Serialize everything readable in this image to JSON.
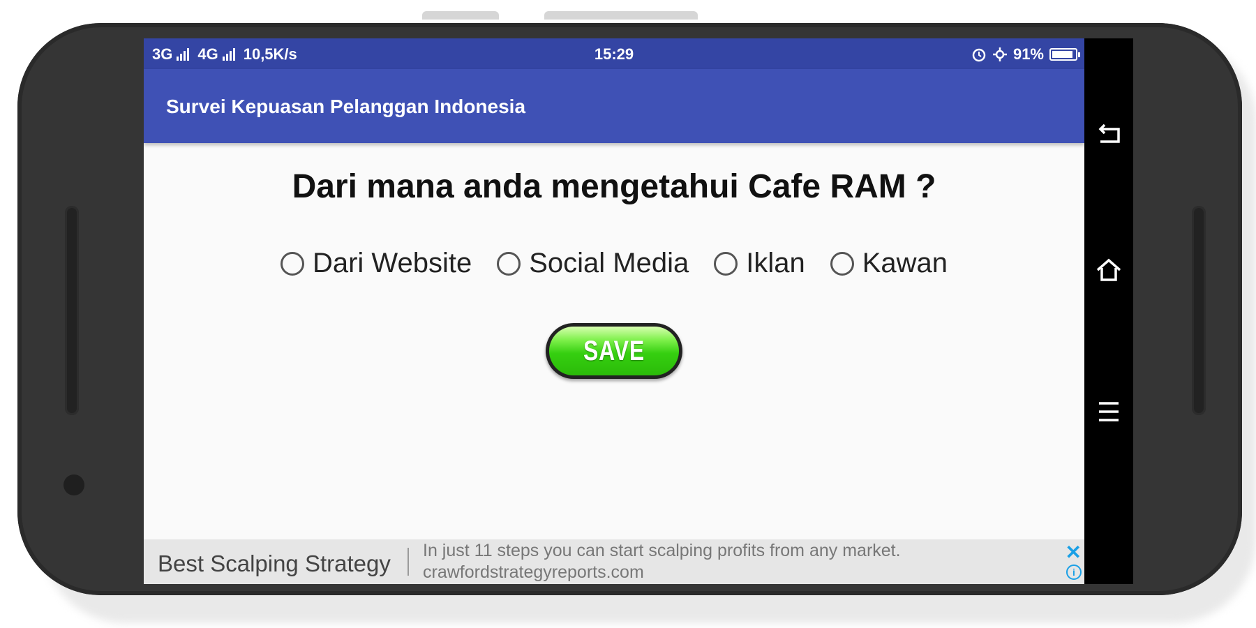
{
  "status_bar": {
    "network_1": "3G",
    "network_2": "4G",
    "speed": "10,5K/s",
    "time": "15:29",
    "battery_percent": "91%",
    "battery_level": 0.91
  },
  "toolbar": {
    "title": "Survei Kepuasan Pelanggan Indonesia"
  },
  "main": {
    "question": "Dari mana anda mengetahui Cafe RAM ?",
    "options": [
      "Dari Website",
      "Social Media",
      "Iklan",
      "Kawan"
    ],
    "save_label": "SAVE"
  },
  "ad": {
    "title": "Best Scalping Strategy",
    "description": "In just 11 steps you can start scalping profits from any market.",
    "url": "crawfordstrategyreports.com",
    "close_label": "✕",
    "info_label": "i"
  },
  "navigation": {
    "icons": [
      "back-icon",
      "home-icon",
      "menu-icon"
    ]
  },
  "colors": {
    "status_bar": "#3445a4",
    "toolbar": "#3f51b5",
    "save_button": "#35cf10",
    "ad_accent": "#1aa0e6"
  }
}
